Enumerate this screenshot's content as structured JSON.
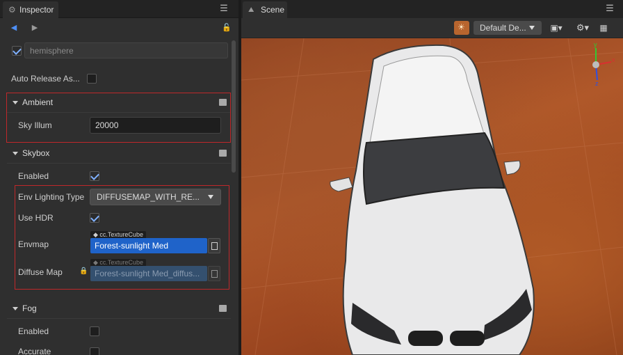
{
  "inspector": {
    "tab_label": "Inspector",
    "node_name": "hemisphere",
    "auto_release": {
      "label": "Auto Release As...",
      "checked": false
    },
    "ambient": {
      "title": "Ambient",
      "sky_illum": {
        "label": "Sky Illum",
        "value": "20000"
      }
    },
    "skybox": {
      "title": "Skybox",
      "enabled": {
        "label": "Enabled",
        "checked": true
      },
      "env_lighting": {
        "label": "Env Lighting Type",
        "value": "DIFFUSEMAP_WITH_RE..."
      },
      "use_hdr": {
        "label": "Use HDR",
        "checked": true
      },
      "envmap": {
        "label": "Envmap",
        "type": "cc.TextureCube",
        "value": "Forest-sunlight Med"
      },
      "diffuse_map": {
        "label": "Diffuse Map",
        "type": "cc.TextureCube",
        "value": "Forest-sunlight Med_diffus..."
      }
    },
    "fog": {
      "title": "Fog",
      "enabled": {
        "label": "Enabled",
        "checked": false
      },
      "accurate": {
        "label": "Accurate"
      }
    }
  },
  "scene": {
    "tab_label": "Scene",
    "camera_dropdown": "Default De...",
    "gizmo_axes": {
      "x": "x",
      "y": "y",
      "z": "z"
    }
  },
  "colors": {
    "panel": "#2f2f2f",
    "highlight_border": "#c0282a",
    "selected_asset": "#1f63c9",
    "accent_orange": "#b8652e"
  }
}
